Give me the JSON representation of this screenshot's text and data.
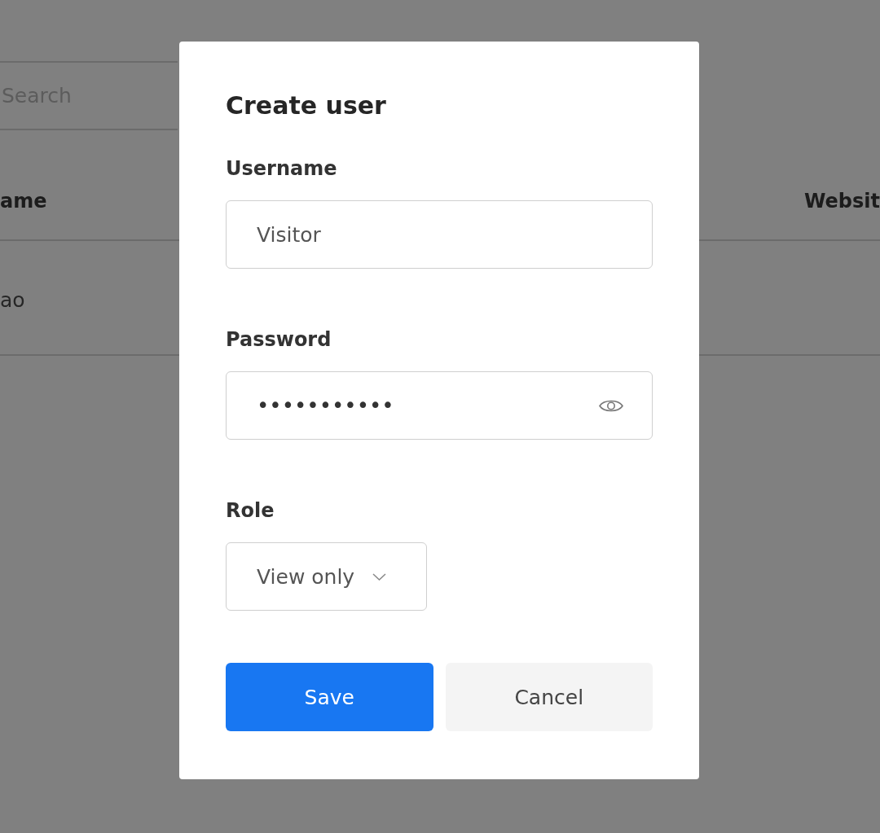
{
  "background_page": {
    "search": {
      "placeholder": "Search"
    },
    "table": {
      "columns": [
        "ame",
        "Websit"
      ],
      "rows": [
        [
          "ao"
        ]
      ]
    }
  },
  "dialog": {
    "title": "Create user",
    "fields": [
      {
        "kind": "text",
        "label": "Username",
        "value": "Visitor"
      },
      {
        "kind": "password",
        "label": "Password",
        "value": "•••••••••••"
      },
      {
        "kind": "select",
        "label": "Role",
        "value": "View only"
      }
    ],
    "buttons": [
      {
        "kind": "primary",
        "label": "Save"
      },
      {
        "kind": "secondary",
        "label": "Cancel"
      }
    ]
  }
}
